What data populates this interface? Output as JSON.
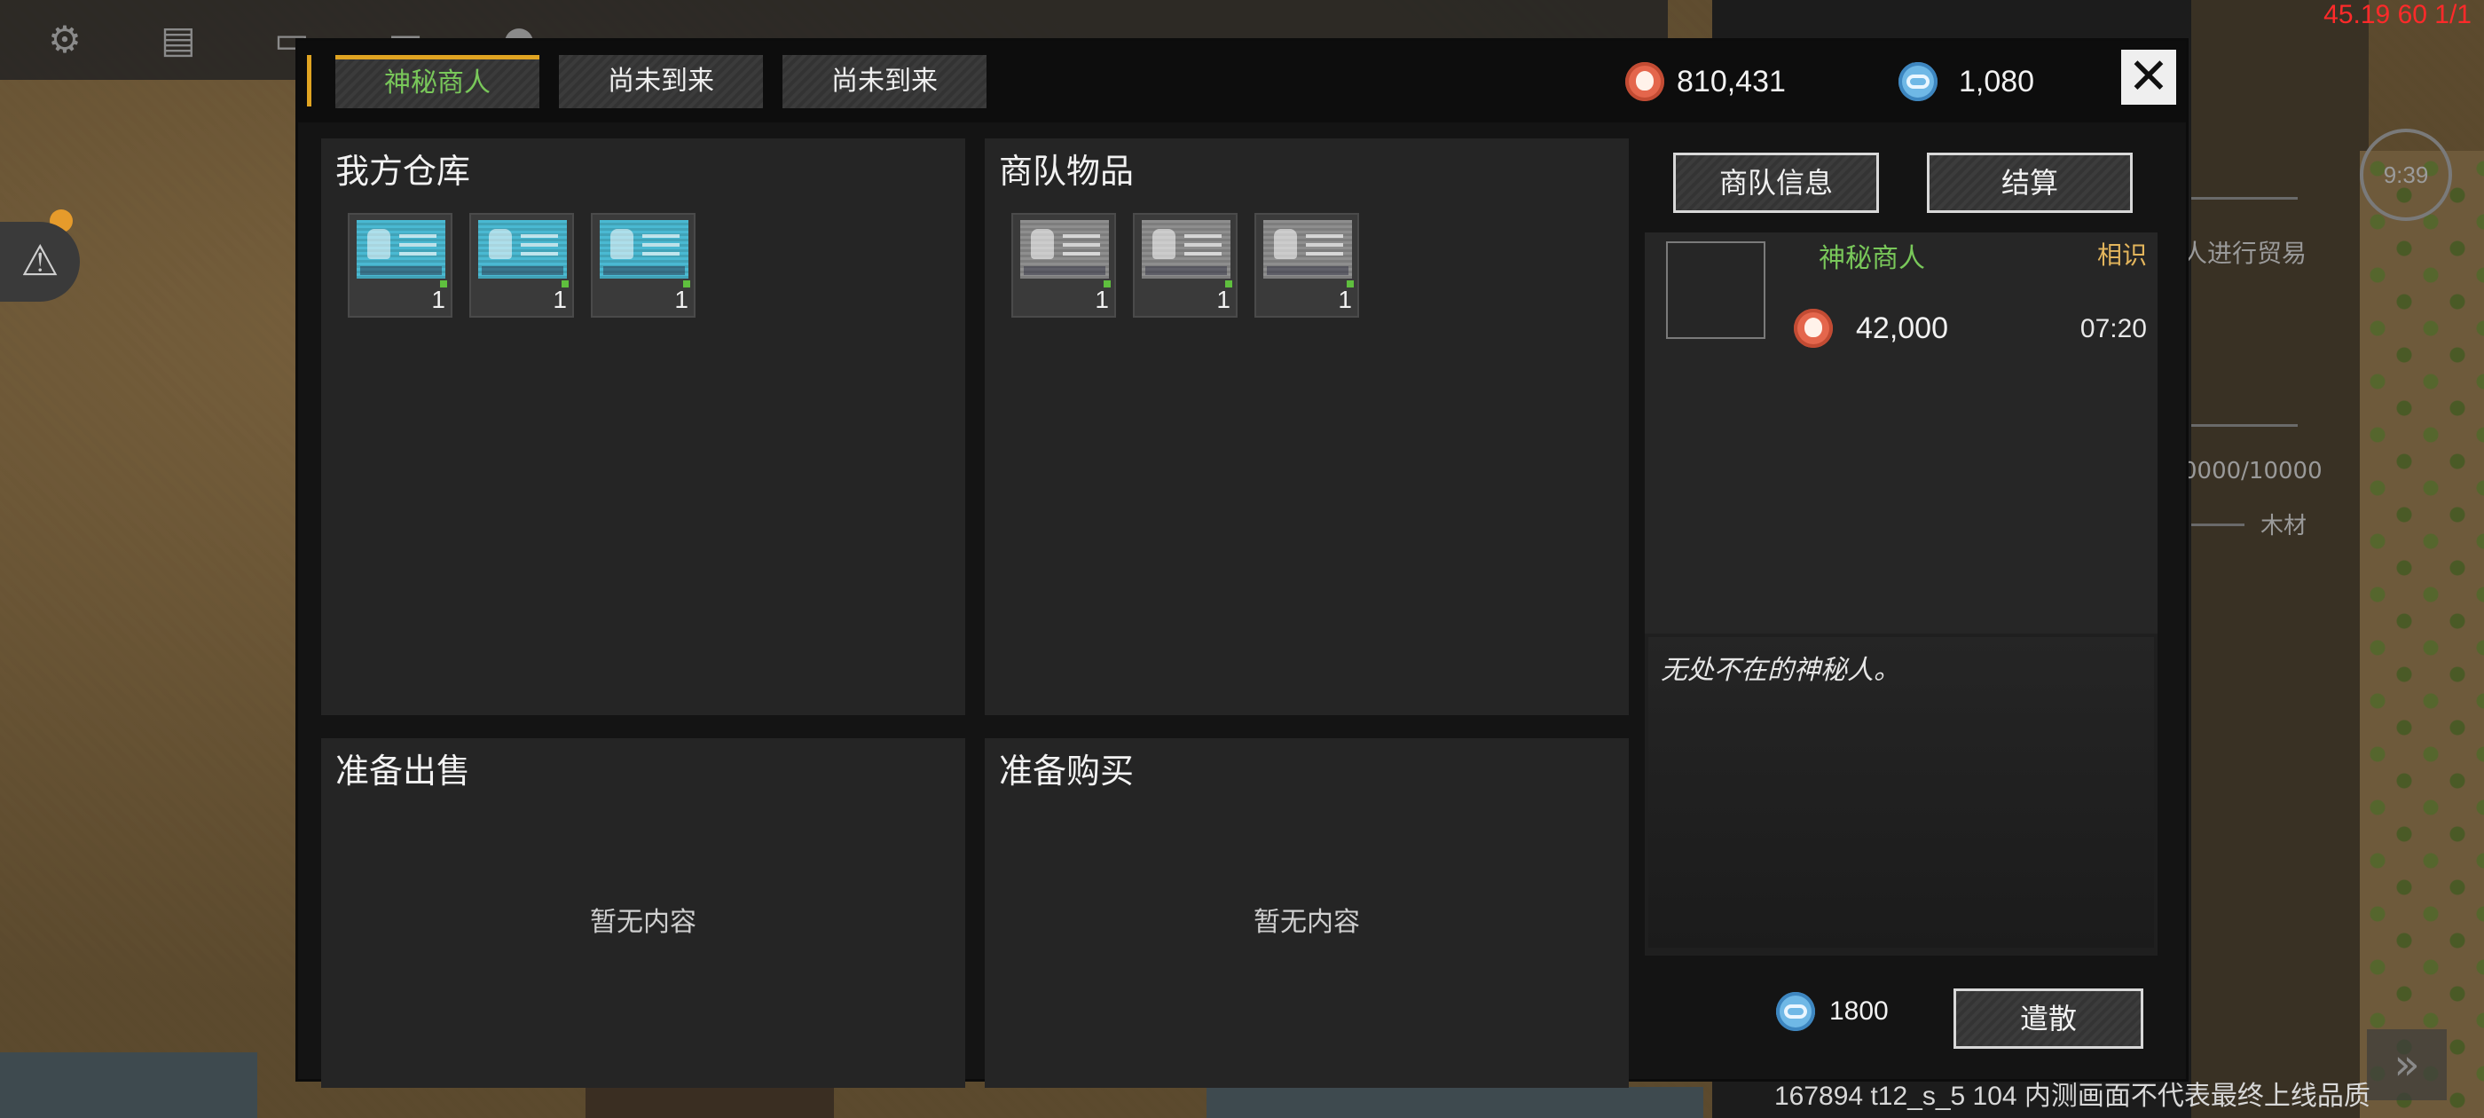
{
  "hud": {
    "fps_text": "45.19 60 1/1",
    "top_icons": [
      "gear-icon",
      "chat-icon",
      "card-icon",
      "box-icon",
      "person-icon"
    ],
    "side_clock": "9:39",
    "side_text_1": "人进行贸易",
    "side_text_2": "0000/10000",
    "side_text_3": "木材",
    "watermark": "167894 t12_s_5 104  内测画面不代表最终上线品质"
  },
  "tabs": [
    {
      "label": "神秘商人",
      "active": true
    },
    {
      "label": "尚未到来",
      "active": false
    },
    {
      "label": "尚未到来",
      "active": false
    }
  ],
  "currency": {
    "gold": "810,431",
    "gems": "1,080",
    "gold_color": "#e4664c",
    "gem_color": "#6fb8e6"
  },
  "warehouse": {
    "title": "我方仓库",
    "items": [
      {
        "icon": "cyan-blueprint-card-icon",
        "count": "1"
      },
      {
        "icon": "cyan-blueprint-card-icon",
        "count": "1"
      },
      {
        "icon": "cyan-blueprint-card-icon",
        "count": "1"
      }
    ]
  },
  "caravan": {
    "title": "商队物品",
    "items": [
      {
        "icon": "gray-blueprint-card-icon",
        "count": "1"
      },
      {
        "icon": "gray-blueprint-card-icon",
        "count": "1"
      },
      {
        "icon": "gray-blueprint-card-icon",
        "count": "1"
      }
    ]
  },
  "sell": {
    "title": "准备出售",
    "empty": "暂无内容"
  },
  "buy": {
    "title": "准备购买",
    "empty": "暂无内容"
  },
  "buttons": {
    "caravan_info": "商队信息",
    "settle": "结算",
    "dismiss": "遣散"
  },
  "merchant": {
    "name": "神秘商人",
    "relation": "相识",
    "price": "42,000",
    "timer": "07:20",
    "description": "无处不在的神秘人。",
    "name_color": "#79c85a",
    "relation_color": "#e3b55c"
  },
  "fee": "1800"
}
